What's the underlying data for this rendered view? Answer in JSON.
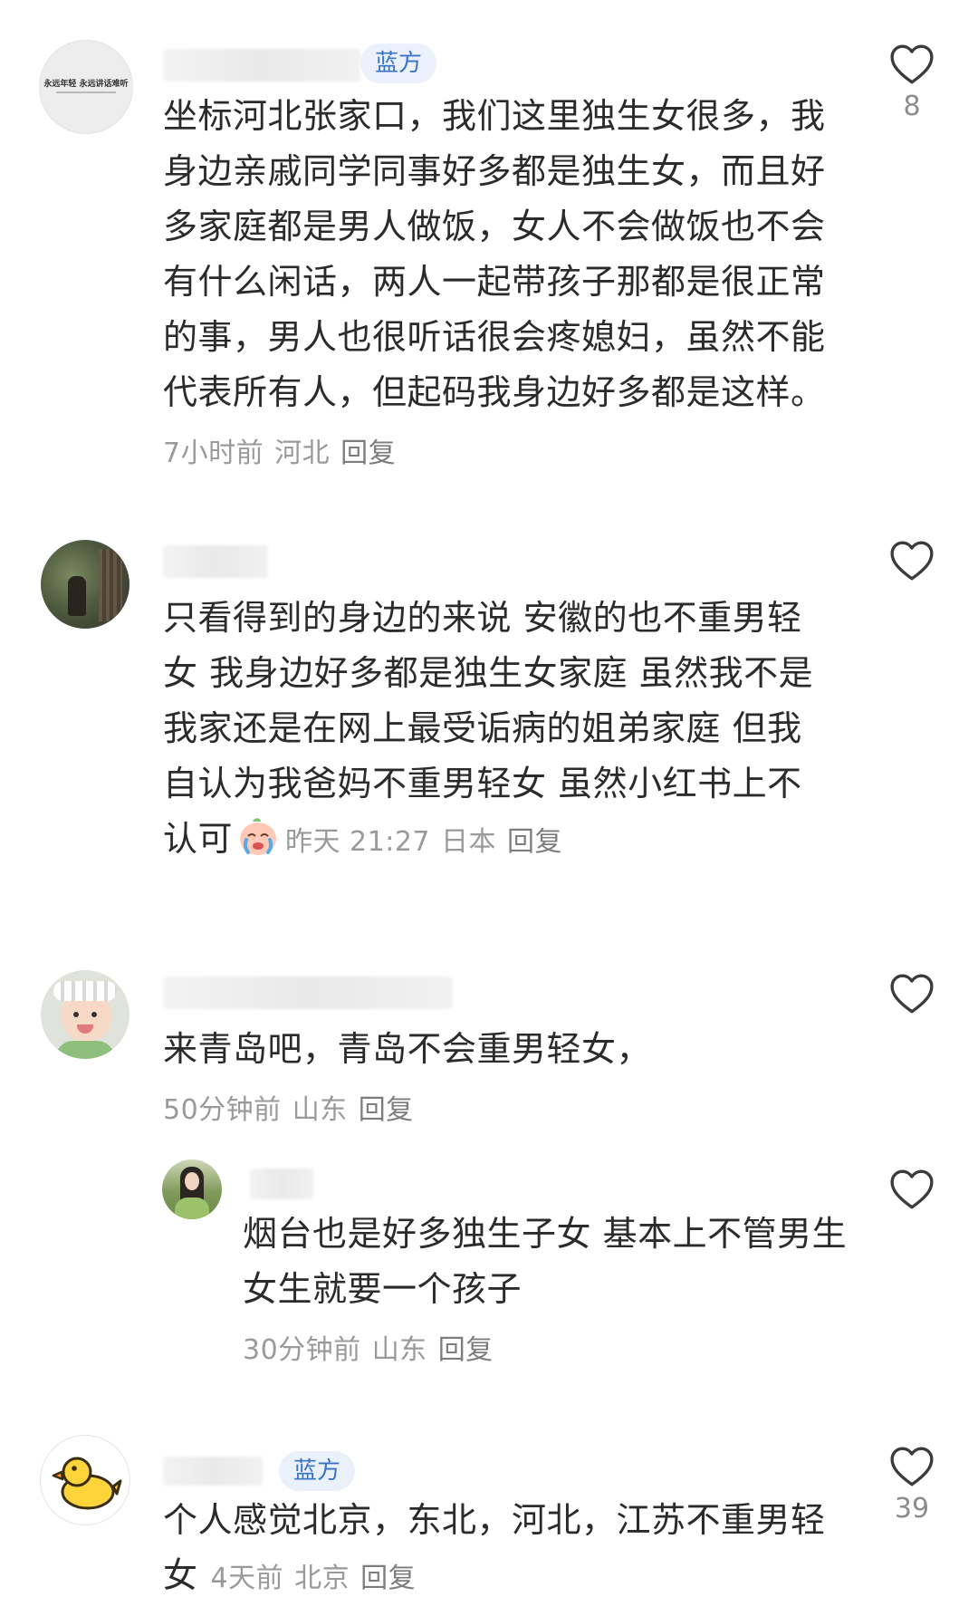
{
  "comments": [
    {
      "badge": "蓝方",
      "avatar_text": "永远年轻 永远讲话难听",
      "content": "坐标河北张家口，我们这里独生女很多，我身边亲戚同学同事好多都是独生女，而且好多家庭都是男人做饭，女人不会做饭也不会有什么闲话，两人一起带孩子那都是很正常的事，男人也很听话很会疼媳妇，虽然不能代表所有人，但起码我身边好多都是这样。",
      "time": "7小时前",
      "location": "河北",
      "reply": "回复",
      "likes": "8"
    },
    {
      "content": "只看得到的身边的来说 安徽的也不重男轻女 我身边好多都是独生女家庭 虽然我不是我家还是在网上最受诟病的姐弟家庭 但我自认为我爸妈不重男轻女 虽然小红书上不认可",
      "emoji": "crying-face",
      "time": "昨天 21:27",
      "location": "日本",
      "reply": "回复"
    },
    {
      "content": "来青岛吧，青岛不会重男轻女，",
      "time": "50分钟前",
      "location": "山东",
      "reply": "回复",
      "replies": [
        {
          "content": "烟台也是好多独生子女  基本上不管男生女生就要一个孩子",
          "time": "30分钟前",
          "location": "山东",
          "reply": "回复"
        }
      ]
    },
    {
      "badge": "蓝方",
      "avatar": "duck",
      "content": "个人感觉北京，东北，河北，江苏不重男轻女",
      "time": "4天前",
      "location": "北京",
      "reply": "回复",
      "likes": "39"
    }
  ],
  "colors": {
    "badge_bg": "#eaf1fb",
    "badge_text": "#3a73c6",
    "meta_text": "#9a9a9a",
    "content_text": "#2b2b2b"
  }
}
